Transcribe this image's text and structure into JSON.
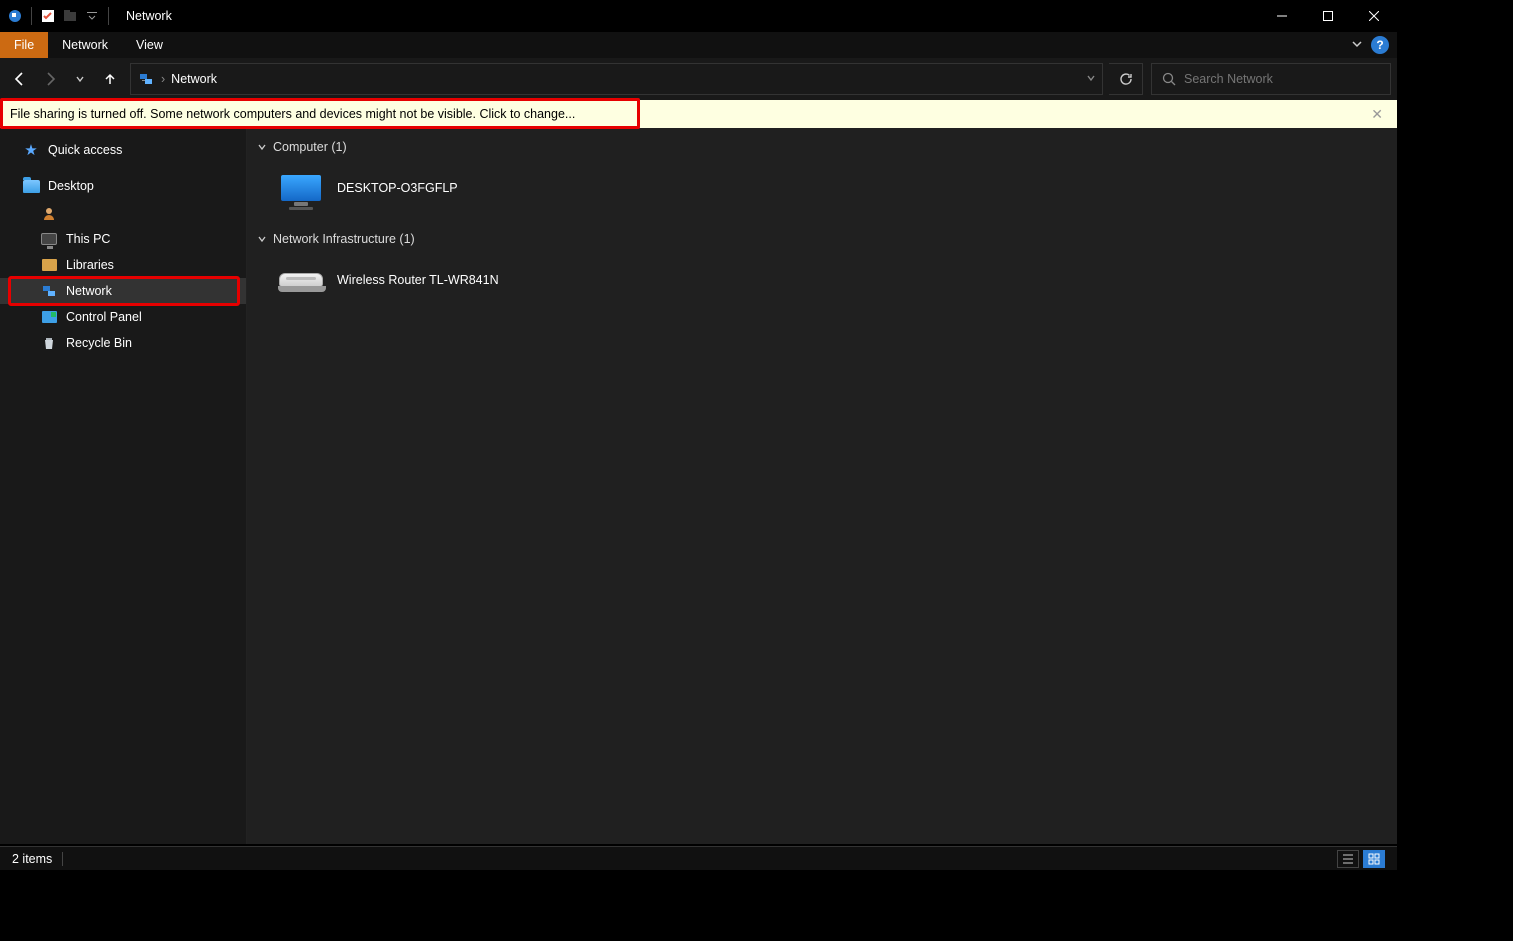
{
  "title": "Network",
  "ribbon": {
    "file": "File",
    "network": "Network",
    "view": "View"
  },
  "address": {
    "location": "Network",
    "search_placeholder": "Search Network"
  },
  "infobar": {
    "message": "File sharing is turned off. Some network computers and devices might not be visible. Click to change..."
  },
  "sidebar": {
    "quick_access": "Quick access",
    "desktop": "Desktop",
    "this_pc": "This PC",
    "libraries": "Libraries",
    "network": "Network",
    "control_panel": "Control Panel",
    "recycle_bin": "Recycle Bin"
  },
  "content": {
    "group_computer": "Computer (1)",
    "computer_name": "DESKTOP-O3FGFLP",
    "group_infra": "Network Infrastructure (1)",
    "router_name": "Wireless Router TL-WR841N"
  },
  "statusbar": {
    "count": "2 items"
  }
}
